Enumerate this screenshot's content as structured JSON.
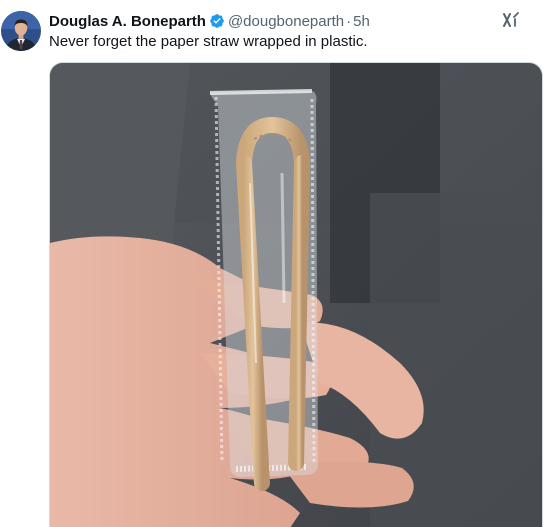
{
  "author": {
    "name": "Douglas A. Boneparth",
    "handle": "@dougboneparth",
    "separator": "·",
    "time": "5h",
    "verified": true
  },
  "tweet": {
    "text": "Never forget the paper straw wrapped in plastic."
  },
  "icons": {
    "avatar": "avatar-photo",
    "verified": "verified-badge-icon",
    "grok": "grok-icon"
  },
  "media": {
    "kind": "photo"
  },
  "colors": {
    "name": "#0f1419",
    "secondary": "#536471",
    "verified": "#1d9bf0",
    "border": "#cfd9de"
  }
}
